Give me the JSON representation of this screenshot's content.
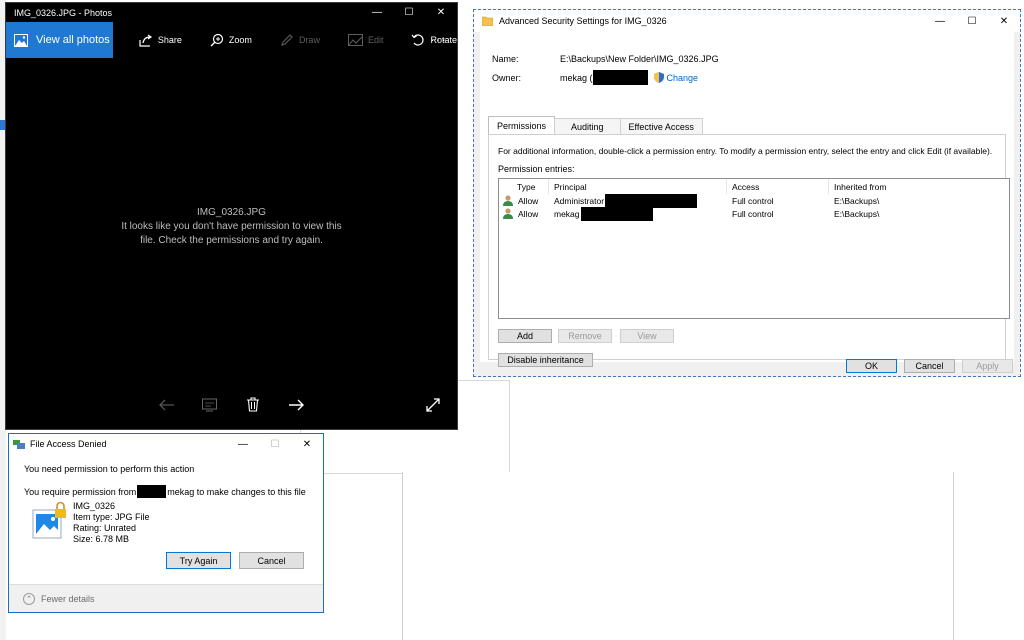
{
  "photos": {
    "title": "IMG_0326.JPG - Photos",
    "view_all": "View all photos",
    "toolbar": {
      "share": "Share",
      "zoom": "Zoom",
      "draw": "Draw",
      "edit": "Edit",
      "rotate": "Rotate",
      "more": "···"
    },
    "message": {
      "filename": "IMG_0326.JPG",
      "text": "It looks like you don't have permission to view this file. Check the permissions and try again."
    },
    "icons": [
      "photo-icon",
      "share-icon",
      "zoom-icon",
      "draw-icon",
      "edit-icon",
      "rotate-icon",
      "back-arrow-icon",
      "slideshow-icon",
      "delete-icon",
      "forward-arrow-icon",
      "fullscreen-icon"
    ]
  },
  "file_access_denied": {
    "title": "File Access Denied",
    "need_permission": "You need permission to perform this action",
    "require_prefix": "You require permission from",
    "require_suffix": "mekag to make changes to this file",
    "file": {
      "name": "IMG_0326",
      "type": "Item type: JPG File",
      "rating": "Rating: Unrated",
      "size": "Size: 6.78 MB"
    },
    "buttons": {
      "try_again": "Try Again",
      "cancel": "Cancel"
    },
    "fewer_details": "Fewer details"
  },
  "advanced_security": {
    "title": "Advanced Security Settings for IMG_0326",
    "name_label": "Name:",
    "name_value": "E:\\Backups\\New Folder\\IMG_0326.JPG",
    "owner_label": "Owner:",
    "owner_value": "mekag (",
    "change_link": "Change",
    "tabs": [
      "Permissions",
      "Auditing",
      "Effective Access"
    ],
    "info_text": "For additional information, double-click a permission entry. To modify a permission entry, select the entry and click Edit (if available).",
    "entries_label": "Permission entries:",
    "columns": [
      "Type",
      "Principal",
      "Access",
      "Inherited from"
    ],
    "rows": [
      {
        "type": "Allow",
        "principal": "Administrator",
        "access": "Full control",
        "inherited": "E:\\Backups\\"
      },
      {
        "type": "Allow",
        "principal": "mekag",
        "access": "Full control",
        "inherited": "E:\\Backups\\"
      }
    ],
    "buttons": {
      "add": "Add",
      "remove": "Remove",
      "view": "View",
      "disable_inheritance": "Disable inheritance",
      "ok": "OK",
      "cancel": "Cancel",
      "apply": "Apply"
    }
  },
  "colors": {
    "accent": "#1f78d1",
    "photos_bg": "#000000",
    "dialog_bg": "#f0f0f0",
    "link": "#0066cc"
  }
}
